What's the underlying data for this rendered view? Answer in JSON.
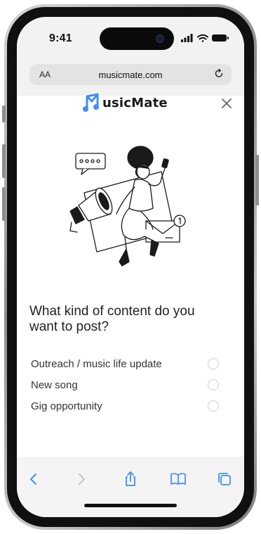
{
  "status_bar": {
    "time": "9:41"
  },
  "browser": {
    "text_size_label": "AA",
    "url": "musicmate.com"
  },
  "app": {
    "logo_text": "usicMate",
    "question": "What kind of content do you want to post?",
    "options": [
      {
        "label": "Outreach / music life update",
        "selected": false
      },
      {
        "label": "New song",
        "selected": false
      },
      {
        "label": "Gig opportunity",
        "selected": false
      }
    ]
  },
  "colors": {
    "brand_blue": "#3f8ef5",
    "toolbar_accent": "#3f8ef5"
  },
  "icons": {
    "close": "close-icon",
    "back": "chevron-left-icon",
    "forward": "chevron-right-icon",
    "share": "share-icon",
    "bookmarks": "book-icon",
    "tabs": "tabs-icon"
  }
}
